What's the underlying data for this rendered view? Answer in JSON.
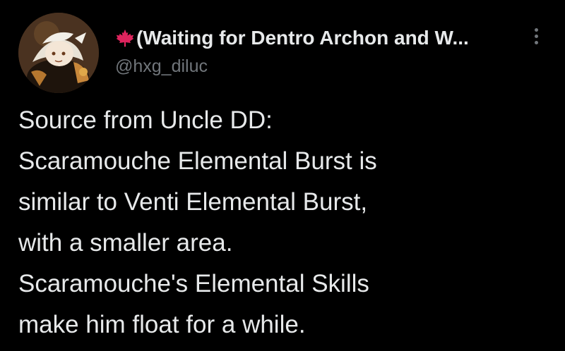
{
  "author": {
    "display_name": "(Waiting for Dentro Archon and W...",
    "handle": "@hxg_diluc",
    "flag_icon": "maple-leaf-icon",
    "flag_color": "#e0245e",
    "avatar_icon": "profile-avatar"
  },
  "menu": {
    "icon": "more-options-icon"
  },
  "tweet": {
    "lines": [
      "Source from Uncle DD:",
      "Scaramouche Elemental Burst is",
      "similar to Venti Elemental Burst,",
      "with a smaller area.",
      "Scaramouche's Elemental Skills",
      "make him float for a while."
    ]
  },
  "colors": {
    "background": "#000000",
    "text_primary": "#e7e9ea",
    "text_secondary": "#71767b"
  }
}
